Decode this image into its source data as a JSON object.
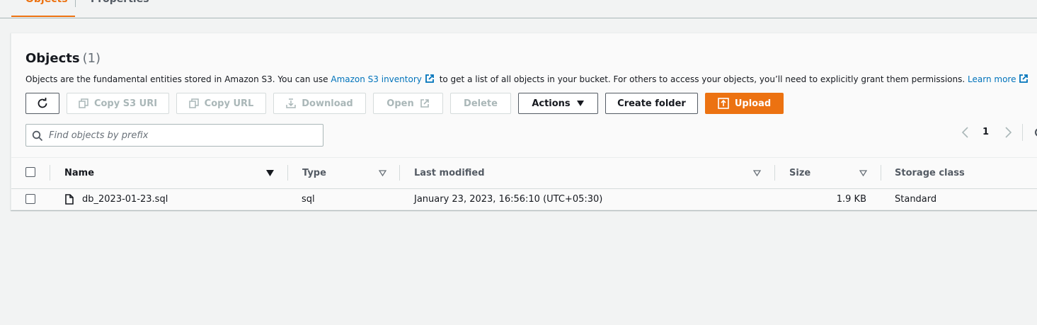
{
  "tabs": [
    {
      "label": "Objects",
      "active": true
    },
    {
      "label": "Properties",
      "active": false
    }
  ],
  "objects": {
    "title": "Objects",
    "count": "(1)",
    "description_prefix": "Objects are the fundamental entities stored in Amazon S3. You can use",
    "inventory_link": "Amazon S3 inventory",
    "description_suffix": "to get a list of all objects in your bucket. For others to access your objects, you’ll need to explicitly grant them permissions.",
    "learn_more": "Learn more"
  },
  "toolbar": {
    "copy_s3_uri": "Copy S3 URI",
    "copy_url": "Copy URL",
    "download": "Download",
    "open": "Open",
    "delete": "Delete",
    "actions": "Actions",
    "create_folder": "Create folder",
    "upload": "Upload"
  },
  "search": {
    "placeholder": "Find objects by prefix"
  },
  "pagination": {
    "current_page": "1"
  },
  "table": {
    "columns": {
      "name": "Name",
      "type": "Type",
      "last_modified": "Last modified",
      "size": "Size",
      "storage_class": "Storage class"
    },
    "rows": [
      {
        "name": "db_2023-01-23.sql",
        "type": "sql",
        "last_modified": "January 23, 2023, 16:56:10 (UTC+05:30)",
        "size": "1.9 KB",
        "storage_class": "Standard"
      }
    ]
  },
  "colors": {
    "accent": "#ec7211",
    "link": "#0073bb",
    "disabled": "#aab7b8"
  }
}
